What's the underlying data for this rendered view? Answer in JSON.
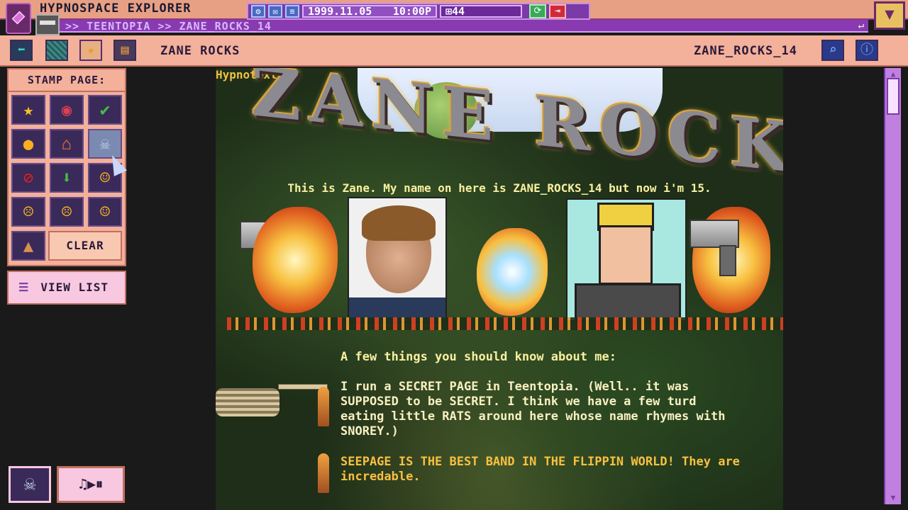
{
  "window": {
    "title": "HYPNOSPACE EXPLORER",
    "date": "1999.11.05",
    "time": "10:00P",
    "hypnocoin": "44"
  },
  "address": {
    "path": ">> TEENTOPIA >> ZANE_ROCKS_14"
  },
  "toolbar": {
    "page_name": "ZANE ROCKS",
    "page_id": "ZANE_ROCKS_14"
  },
  "sidebar": {
    "stamp_title": "STAMP PAGE:",
    "stamps": [
      {
        "icon": "star-icon",
        "glyph": "★",
        "color": "#f8c020"
      },
      {
        "icon": "eye-icon",
        "glyph": "◉",
        "color": "#e04050"
      },
      {
        "icon": "check-icon",
        "glyph": "✔",
        "color": "#40c040"
      },
      {
        "icon": "coin-icon",
        "glyph": "●",
        "color": "#f8b020"
      },
      {
        "icon": "house-icon",
        "glyph": "⌂",
        "color": "#c06040"
      },
      {
        "icon": "skull-icon",
        "glyph": "☠",
        "color": "#c0d0e0"
      },
      {
        "icon": "no-icon",
        "glyph": "⊘",
        "color": "#e02020"
      },
      {
        "icon": "down-arrow-icon",
        "glyph": "⬇",
        "color": "#40c040"
      },
      {
        "icon": "thumbs-up-icon",
        "glyph": "☺",
        "color": "#f8b020"
      },
      {
        "icon": "angry-face-icon",
        "glyph": "☹",
        "color": "#f8b020"
      },
      {
        "icon": "mad-face-icon",
        "glyph": "☹",
        "color": "#f8b020"
      },
      {
        "icon": "shocked-face-icon",
        "glyph": "☺",
        "color": "#f8b020"
      }
    ],
    "clear_label": "CLEAR",
    "view_list_label": "VIEW LIST"
  },
  "page": {
    "hypnotext_label": "Hypnotext",
    "headline": "ZANE ROCKS",
    "intro": "This is Zane. My name on here is ZANE_ROCKS_14 but now i'm 15.",
    "about_heading": "A few things you should know about me:",
    "item1": "I run a SECRET PAGE in Teentopia. (Well.. it was SUPPOSED to be SECRET. I think we have a few turd eating little RATS around here whose name rhymes with SNOREY.)",
    "item2": "SEEPAGE IS THE BEST BAND IN THE FLIPPIN WORLD! They are incredable."
  },
  "colors": {
    "titlebar": "#e8a085",
    "addressbar": "#8a3ab0",
    "toolbar": "#f3b09a",
    "scrollbar": "#c080e0"
  }
}
